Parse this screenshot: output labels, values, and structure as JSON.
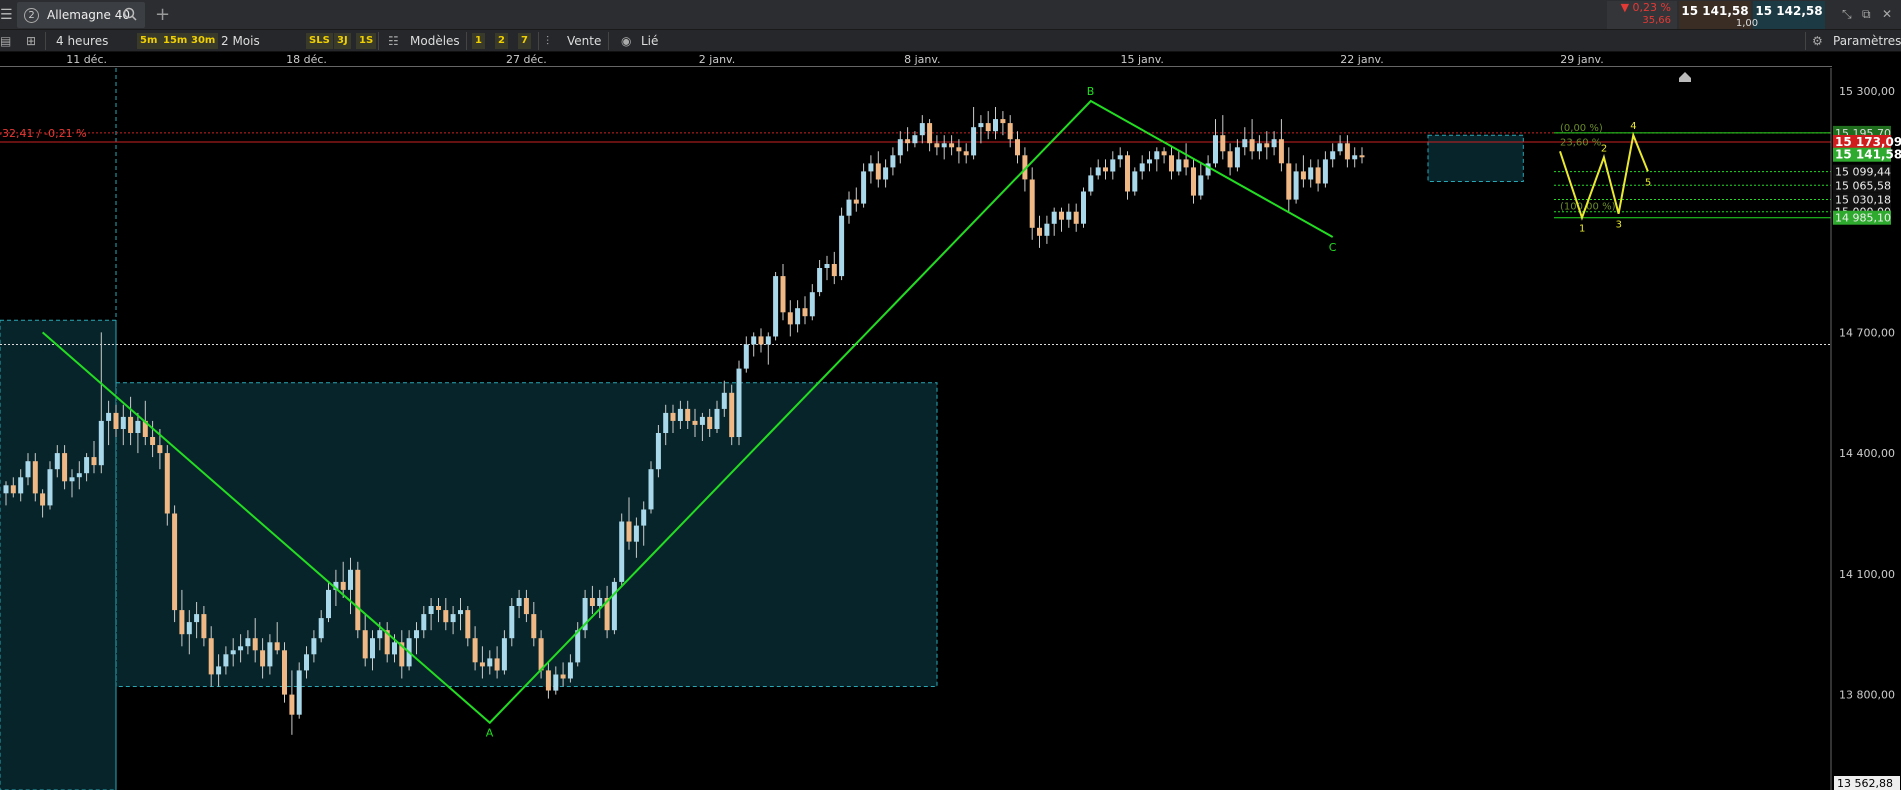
{
  "header": {
    "instrument_number": "2",
    "instrument_name": "Allemagne 40",
    "change_percent": "▼ 0,23 %",
    "change_points": "35,66",
    "bid": "15 141,58",
    "ask": "15 142,58",
    "spread": "1,00"
  },
  "toolbar": {
    "timeframe": "4 heures",
    "interval_5m": "5m",
    "interval_15m": "15m",
    "interval_30m": "30m",
    "range": "2 Mois",
    "tag_sls": "SLS",
    "tag_3j": "3J",
    "tag_1s": "1S",
    "templates": "Modèles",
    "preset_1": "1",
    "preset_2": "2",
    "preset_7": "7",
    "sell": "Vente",
    "linked": "Lié",
    "settings": "Paramètres"
  },
  "colors": {
    "background": "#000000",
    "bull_candle": "#a8d8ea",
    "bear_candle": "#f0b884",
    "zigzag": "#22dd22",
    "elliott": "#e8e830",
    "current_price_tag": "#2eaa2e",
    "red_line": "#cc2222",
    "box_fill": "#072a30",
    "box_border": "#2aa7b5"
  },
  "chart_data": {
    "type": "candlestick",
    "xaxis_labels": [
      "11 déc.",
      "18 déc.",
      "27 déc.",
      "2 janv.",
      "8 janv.",
      "15 janv.",
      "22 janv.",
      "29 janv."
    ],
    "xaxis_label_index": [
      11,
      41,
      71,
      97,
      125,
      155,
      185,
      215
    ],
    "price_axis_labels": [
      {
        "label": "15 300,00",
        "value": 15300
      },
      {
        "label": "14 700,00",
        "value": 14700
      },
      {
        "label": "14 400,00",
        "value": 14400
      },
      {
        "label": "14 100,00",
        "value": 14100
      },
      {
        "label": "13 800,00",
        "value": 13800
      },
      {
        "label": "13 562,88",
        "value": 13562.88
      }
    ],
    "ylim": [
      13562.88,
      15357
    ],
    "current_price": {
      "label": "15 141,58",
      "value": 15141.58
    },
    "red_level": {
      "label": "15 173,09",
      "value": 15173.09
    },
    "top_level": {
      "label": "15 195,70",
      "value": 15195.7
    },
    "level_tags": [
      {
        "label": "15 099,44",
        "value": 15099.44
      },
      {
        "label": "15 065,58",
        "value": 15065.58
      },
      {
        "label": "15 030,18",
        "value": 15030.18
      },
      {
        "label": "15 000,00",
        "value": 15000.0
      },
      {
        "label": "14 985,10",
        "value": 14985.1
      }
    ],
    "fib_labels": [
      {
        "label": "(0,00 %)",
        "value": 15195.7
      },
      {
        "label": "23,60 %",
        "value": 15160.0
      },
      {
        "label": "(100,00 %)",
        "value": 15000.0
      }
    ],
    "change_text": "-32,41 / -0,21 %",
    "zigzag": [
      {
        "i": 5,
        "v": 14700,
        "label": ""
      },
      {
        "i": 66,
        "v": 13730,
        "label": "A"
      },
      {
        "i": 148,
        "v": 15275,
        "label": "B"
      },
      {
        "i": 181,
        "v": 14937,
        "label": "C"
      }
    ],
    "elliott": [
      {
        "i": 212,
        "v": 15150,
        "label": ""
      },
      {
        "i": 215,
        "v": 14985,
        "label": "1"
      },
      {
        "i": 218,
        "v": 15135,
        "label": "2"
      },
      {
        "i": 220,
        "v": 14995,
        "label": "3"
      },
      {
        "i": 222,
        "v": 15190,
        "label": "4"
      },
      {
        "i": 224,
        "v": 15100,
        "label": "5"
      }
    ],
    "boxes": [
      {
        "i0": 0,
        "i1": 15,
        "hi": 14730,
        "lo": 13562.88
      },
      {
        "i0": 15,
        "i1": 127,
        "hi": 14575,
        "lo": 13820
      },
      {
        "i0": 194,
        "i1": 207,
        "hi": 15190,
        "lo": 15075
      }
    ],
    "white_dotted_level": 14670,
    "candles": [
      [
        14300,
        14330,
        14270,
        14320
      ],
      [
        14320,
        14340,
        14290,
        14300
      ],
      [
        14300,
        14360,
        14280,
        14340
      ],
      [
        14340,
        14400,
        14320,
        14380
      ],
      [
        14380,
        14400,
        14280,
        14300
      ],
      [
        14300,
        14310,
        14240,
        14270
      ],
      [
        14270,
        14380,
        14260,
        14360
      ],
      [
        14360,
        14420,
        14340,
        14400
      ],
      [
        14400,
        14420,
        14310,
        14330
      ],
      [
        14330,
        14360,
        14290,
        14340
      ],
      [
        14340,
        14380,
        14310,
        14350
      ],
      [
        14350,
        14400,
        14330,
        14390
      ],
      [
        14390,
        14430,
        14350,
        14370
      ],
      [
        14370,
        14700,
        14350,
        14480
      ],
      [
        14480,
        14530,
        14420,
        14500
      ],
      [
        14500,
        14520,
        14440,
        14460
      ],
      [
        14460,
        14520,
        14420,
        14490
      ],
      [
        14490,
        14540,
        14420,
        14450
      ],
      [
        14450,
        14500,
        14400,
        14480
      ],
      [
        14480,
        14530,
        14420,
        14440
      ],
      [
        14440,
        14480,
        14390,
        14420
      ],
      [
        14420,
        14460,
        14360,
        14400
      ],
      [
        14400,
        14420,
        14220,
        14250
      ],
      [
        14250,
        14270,
        13980,
        14010
      ],
      [
        14010,
        14060,
        13920,
        13950
      ],
      [
        13950,
        14010,
        13900,
        13980
      ],
      [
        13980,
        14030,
        13940,
        14000
      ],
      [
        14000,
        14020,
        13920,
        13940
      ],
      [
        13940,
        13970,
        13820,
        13850
      ],
      [
        13850,
        13900,
        13820,
        13870
      ],
      [
        13870,
        13920,
        13850,
        13900
      ],
      [
        13900,
        13940,
        13870,
        13910
      ],
      [
        13910,
        13950,
        13880,
        13920
      ],
      [
        13920,
        13960,
        13900,
        13940
      ],
      [
        13940,
        13990,
        13880,
        13910
      ],
      [
        13910,
        13940,
        13840,
        13870
      ],
      [
        13870,
        13950,
        13850,
        13930
      ],
      [
        13930,
        13980,
        13900,
        13910
      ],
      [
        13910,
        13930,
        13780,
        13800
      ],
      [
        13800,
        13860,
        13700,
        13750
      ],
      [
        13750,
        13880,
        13740,
        13860
      ],
      [
        13860,
        13920,
        13840,
        13900
      ],
      [
        13900,
        13960,
        13880,
        13940
      ],
      [
        13940,
        14010,
        13930,
        13990
      ],
      [
        13990,
        14080,
        13980,
        14060
      ],
      [
        14060,
        14110,
        14020,
        14080
      ],
      [
        14080,
        14130,
        14040,
        14060
      ],
      [
        14060,
        14140,
        14000,
        14110
      ],
      [
        14110,
        14130,
        13940,
        13960
      ],
      [
        13960,
        14000,
        13870,
        13890
      ],
      [
        13890,
        13960,
        13860,
        13940
      ],
      [
        13940,
        13980,
        13910,
        13960
      ],
      [
        13960,
        13980,
        13880,
        13900
      ],
      [
        13900,
        13950,
        13880,
        13930
      ],
      [
        13930,
        13960,
        13840,
        13870
      ],
      [
        13870,
        13960,
        13860,
        13940
      ],
      [
        13940,
        13980,
        13900,
        13960
      ],
      [
        13960,
        14020,
        13940,
        14000
      ],
      [
        14000,
        14040,
        13960,
        14020
      ],
      [
        14020,
        14040,
        13980,
        14010
      ],
      [
        14010,
        14040,
        13960,
        13980
      ],
      [
        13980,
        14020,
        13950,
        14000
      ],
      [
        14000,
        14040,
        13960,
        14010
      ],
      [
        14010,
        14020,
        13920,
        13940
      ],
      [
        13940,
        13970,
        13860,
        13880
      ],
      [
        13880,
        13920,
        13840,
        13870
      ],
      [
        13870,
        13910,
        13850,
        13890
      ],
      [
        13890,
        13920,
        13840,
        13860
      ],
      [
        13860,
        13960,
        13850,
        13940
      ],
      [
        13940,
        14040,
        13920,
        14020
      ],
      [
        14020,
        14060,
        13990,
        14040
      ],
      [
        14040,
        14060,
        13980,
        14000
      ],
      [
        14000,
        14030,
        13920,
        13940
      ],
      [
        13940,
        13960,
        13840,
        13860
      ],
      [
        13860,
        13880,
        13790,
        13810
      ],
      [
        13810,
        13870,
        13800,
        13850
      ],
      [
        13850,
        13880,
        13820,
        13840
      ],
      [
        13840,
        13900,
        13830,
        13880
      ],
      [
        13880,
        13980,
        13870,
        13960
      ],
      [
        13960,
        14060,
        13940,
        14040
      ],
      [
        14040,
        14070,
        14000,
        14020
      ],
      [
        14020,
        14060,
        13990,
        14040
      ],
      [
        14040,
        14070,
        13940,
        13960
      ],
      [
        13960,
        14090,
        13950,
        14080
      ],
      [
        14080,
        14250,
        14070,
        14230
      ],
      [
        14230,
        14290,
        14160,
        14180
      ],
      [
        14180,
        14240,
        14140,
        14220
      ],
      [
        14220,
        14280,
        14170,
        14260
      ],
      [
        14260,
        14380,
        14250,
        14360
      ],
      [
        14360,
        14470,
        14340,
        14450
      ],
      [
        14450,
        14520,
        14420,
        14500
      ],
      [
        14500,
        14520,
        14450,
        14480
      ],
      [
        14480,
        14530,
        14460,
        14510
      ],
      [
        14510,
        14530,
        14460,
        14480
      ],
      [
        14480,
        14510,
        14440,
        14470
      ],
      [
        14470,
        14500,
        14430,
        14490
      ],
      [
        14490,
        14510,
        14440,
        14460
      ],
      [
        14460,
        14530,
        14450,
        14510
      ],
      [
        14510,
        14580,
        14490,
        14550
      ],
      [
        14550,
        14570,
        14420,
        14440
      ],
      [
        14440,
        14630,
        14420,
        14610
      ],
      [
        14610,
        14690,
        14600,
        14670
      ],
      [
        14670,
        14700,
        14640,
        14690
      ],
      [
        14690,
        14710,
        14650,
        14670
      ],
      [
        14670,
        14700,
        14620,
        14690
      ],
      [
        14690,
        14850,
        14680,
        14840
      ],
      [
        14840,
        14870,
        14730,
        14750
      ],
      [
        14750,
        14780,
        14690,
        14720
      ],
      [
        14720,
        14780,
        14700,
        14760
      ],
      [
        14760,
        14790,
        14720,
        14740
      ],
      [
        14740,
        14820,
        14730,
        14800
      ],
      [
        14800,
        14880,
        14790,
        14860
      ],
      [
        14860,
        14890,
        14830,
        14870
      ],
      [
        14870,
        14900,
        14820,
        14840
      ],
      [
        14840,
        15010,
        14830,
        14990
      ],
      [
        14990,
        15050,
        14970,
        15030
      ],
      [
        15030,
        15060,
        15000,
        15020
      ],
      [
        15020,
        15120,
        15010,
        15100
      ],
      [
        15100,
        15140,
        15070,
        15120
      ],
      [
        15120,
        15150,
        15060,
        15080
      ],
      [
        15080,
        15130,
        15060,
        15110
      ],
      [
        15110,
        15160,
        15090,
        15140
      ],
      [
        15140,
        15200,
        15120,
        15180
      ],
      [
        15180,
        15210,
        15150,
        15170
      ],
      [
        15170,
        15200,
        15160,
        15190
      ],
      [
        15190,
        15240,
        15170,
        15220
      ],
      [
        15220,
        15230,
        15150,
        15170
      ],
      [
        15170,
        15190,
        15140,
        15160
      ],
      [
        15160,
        15190,
        15130,
        15170
      ],
      [
        15170,
        15190,
        15140,
        15160
      ],
      [
        15160,
        15180,
        15120,
        15150
      ],
      [
        15150,
        15170,
        15120,
        15140
      ],
      [
        15140,
        15260,
        15130,
        15210
      ],
      [
        15210,
        15240,
        15170,
        15220
      ],
      [
        15220,
        15250,
        15180,
        15200
      ],
      [
        15200,
        15260,
        15180,
        15230
      ],
      [
        15230,
        15250,
        15190,
        15220
      ],
      [
        15220,
        15240,
        15160,
        15180
      ],
      [
        15180,
        15200,
        15120,
        15140
      ],
      [
        15140,
        15160,
        15050,
        15080
      ],
      [
        15080,
        15110,
        14930,
        14960
      ],
      [
        14960,
        14990,
        14910,
        14940
      ],
      [
        14940,
        14990,
        14920,
        14970
      ],
      [
        14970,
        15010,
        14940,
        15000
      ],
      [
        15000,
        15010,
        14950,
        14980
      ],
      [
        14980,
        15020,
        14960,
        15000
      ],
      [
        15000,
        15020,
        14950,
        14970
      ],
      [
        14970,
        15060,
        14960,
        15050
      ],
      [
        15050,
        15110,
        15040,
        15090
      ],
      [
        15090,
        15130,
        15080,
        15110
      ],
      [
        15110,
        15130,
        15080,
        15100
      ],
      [
        15100,
        15150,
        15080,
        15130
      ],
      [
        15130,
        15160,
        15110,
        15140
      ],
      [
        15140,
        15150,
        15030,
        15050
      ],
      [
        15050,
        15110,
        15040,
        15100
      ],
      [
        15100,
        15140,
        15080,
        15120
      ],
      [
        15120,
        15150,
        15100,
        15130
      ],
      [
        15130,
        15160,
        15100,
        15150
      ],
      [
        15150,
        15160,
        15120,
        15140
      ],
      [
        15140,
        15160,
        15080,
        15100
      ],
      [
        15100,
        15150,
        15090,
        15130
      ],
      [
        15130,
        15170,
        15090,
        15110
      ],
      [
        15110,
        15130,
        15020,
        15040
      ],
      [
        15040,
        15120,
        15030,
        15090
      ],
      [
        15090,
        15140,
        15080,
        15120
      ],
      [
        15120,
        15230,
        15110,
        15190
      ],
      [
        15190,
        15240,
        15130,
        15150
      ],
      [
        15150,
        15170,
        15090,
        15110
      ],
      [
        15110,
        15180,
        15100,
        15160
      ],
      [
        15160,
        15210,
        15140,
        15180
      ],
      [
        15180,
        15230,
        15130,
        15150
      ],
      [
        15150,
        15190,
        15130,
        15170
      ],
      [
        15170,
        15200,
        15130,
        15160
      ],
      [
        15160,
        15200,
        15140,
        15180
      ],
      [
        15180,
        15230,
        15100,
        15120
      ],
      [
        15120,
        15160,
        15000,
        15030
      ],
      [
        15030,
        15120,
        15020,
        15100
      ],
      [
        15100,
        15140,
        15060,
        15080
      ],
      [
        15080,
        15130,
        15060,
        15110
      ],
      [
        15110,
        15130,
        15050,
        15070
      ],
      [
        15070,
        15150,
        15060,
        15130
      ],
      [
        15130,
        15170,
        15110,
        15150
      ],
      [
        15150,
        15190,
        15140,
        15170
      ],
      [
        15170,
        15190,
        15110,
        15130
      ],
      [
        15130,
        15160,
        15110,
        15140
      ],
      [
        15140,
        15160,
        15120,
        15135
      ]
    ]
  }
}
